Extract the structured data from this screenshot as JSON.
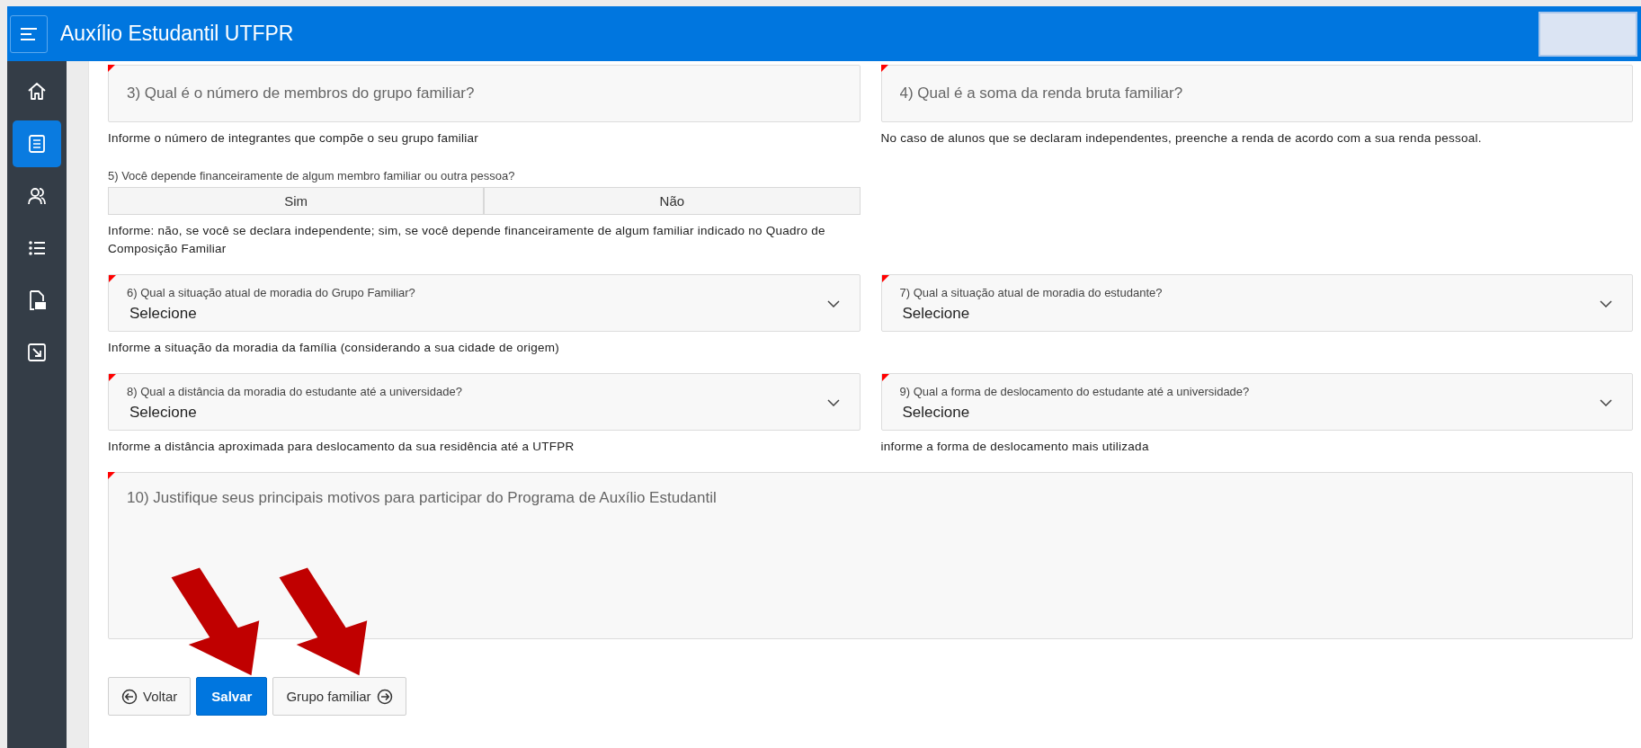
{
  "header": {
    "title": "Auxílio Estudantil UTFPR"
  },
  "sidebar": {
    "items": [
      {
        "kind": "home",
        "selected": false
      },
      {
        "kind": "form",
        "selected": true
      },
      {
        "kind": "users",
        "selected": false
      },
      {
        "kind": "list",
        "selected": false
      },
      {
        "kind": "pdf",
        "selected": false
      },
      {
        "kind": "import",
        "selected": false
      }
    ]
  },
  "form": {
    "rows": [
      [
        {
          "kind": "input",
          "required": true,
          "placeholder": "3) Qual é o número de membros do grupo familiar?",
          "help": "Informe o número de integrantes que compõe o seu grupo familiar"
        },
        {
          "kind": "input",
          "required": true,
          "placeholder": "4) Qual é a soma da renda bruta familiar?",
          "help": "No caso de alunos que se declaram independentes, preenche a renda de acordo com a sua renda pessoal."
        }
      ],
      [
        {
          "kind": "segmented",
          "label": "5) Você depende financeiramente de algum membro familiar ou outra pessoa?",
          "options": [
            {
              "label": "Sim",
              "selected": false
            },
            {
              "label": "Não",
              "selected": false
            }
          ],
          "help": "Informe: não, se você se declara independente; sim, se você depende financeiramente de algum familiar indicado no Quadro de Composição Familiar"
        }
      ],
      [
        {
          "kind": "select",
          "required": true,
          "label": "6) Qual a situação atual de moradia do Grupo Familiar?",
          "value": "Selecione",
          "help": "Informe a situação da moradia da família (considerando a sua cidade de origem)"
        },
        {
          "kind": "select",
          "required": true,
          "label": "7) Qual a situação atual de moradia do estudante?",
          "value": "Selecione"
        }
      ],
      [
        {
          "kind": "select",
          "required": true,
          "label": "8) Qual a distância da moradia do estudante até a universidade?",
          "value": "Selecione",
          "help": "Informe a distância aproximada para deslocamento da sua residência até a UTFPR"
        },
        {
          "kind": "select",
          "required": true,
          "label": "9) Qual a forma de deslocamento do estudante até a universidade?",
          "value": "Selecione",
          "help": "informe a forma de deslocamento mais utilizada"
        }
      ],
      [
        {
          "kind": "textarea",
          "required": true,
          "placeholder": "10) Justifique seus principais motivos para participar do Programa de Auxílio Estudantil"
        }
      ]
    ]
  },
  "buttons": [
    {
      "kind": "back",
      "label": "Voltar",
      "pointed": false
    },
    {
      "kind": "primary",
      "label": "Salvar",
      "pointed": true
    },
    {
      "kind": "next",
      "label": "Grupo familiar",
      "pointed": true
    }
  ]
}
